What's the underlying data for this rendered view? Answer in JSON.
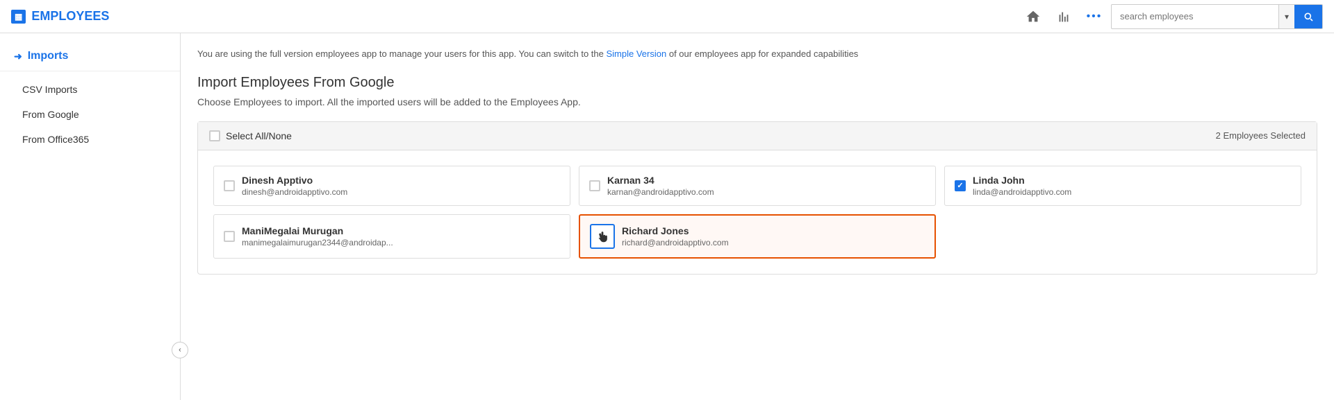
{
  "header": {
    "logo_icon": "▦",
    "logo_text": "EMPLOYEES",
    "home_icon": "⌂",
    "chart_icon": "▦",
    "more_icon": "•••",
    "search_placeholder": "search employees",
    "search_dropdown_icon": "▾",
    "search_go_icon": "🔍"
  },
  "sidebar": {
    "arrow_icon": "➜",
    "title": "Imports",
    "nav_items": [
      {
        "label": "CSV Imports"
      },
      {
        "label": "From Google"
      },
      {
        "label": "From Office365"
      }
    ],
    "collapse_icon": "‹"
  },
  "main": {
    "info_text_before": "You are using the full version employees app to manage your users for this app. You can switch to the ",
    "info_link": "Simple Version",
    "info_text_after": " of our employees app for expanded capabilities",
    "page_title": "Import Employees From Google",
    "page_subtitle": "Choose Employees to import. All the imported users will be added to the Employees App.",
    "selection_panel": {
      "select_all_label": "Select All/None",
      "employee_count": "2 Employees Selected",
      "employees": [
        {
          "id": "e1",
          "name": "Dinesh Apptivo",
          "email": "dinesh@androidapptivo.com",
          "checked": false,
          "active": false,
          "row": 0,
          "col": 0
        },
        {
          "id": "e2",
          "name": "Karnan 34",
          "email": "karnan@androidapptivo.com",
          "checked": false,
          "active": false,
          "row": 0,
          "col": 1
        },
        {
          "id": "e3",
          "name": "Linda John",
          "email": "linda@androidapptivo.com",
          "checked": true,
          "active": false,
          "row": 0,
          "col": 2
        },
        {
          "id": "e4",
          "name": "ManiMegalai Murugan",
          "email": "manimegalaimurugan2344@androidap...",
          "checked": false,
          "active": false,
          "row": 1,
          "col": 0
        },
        {
          "id": "e5",
          "name": "Richard Jones",
          "email": "richard@androidapptivo.com",
          "checked": false,
          "active": true,
          "row": 1,
          "col": 1
        }
      ]
    }
  }
}
